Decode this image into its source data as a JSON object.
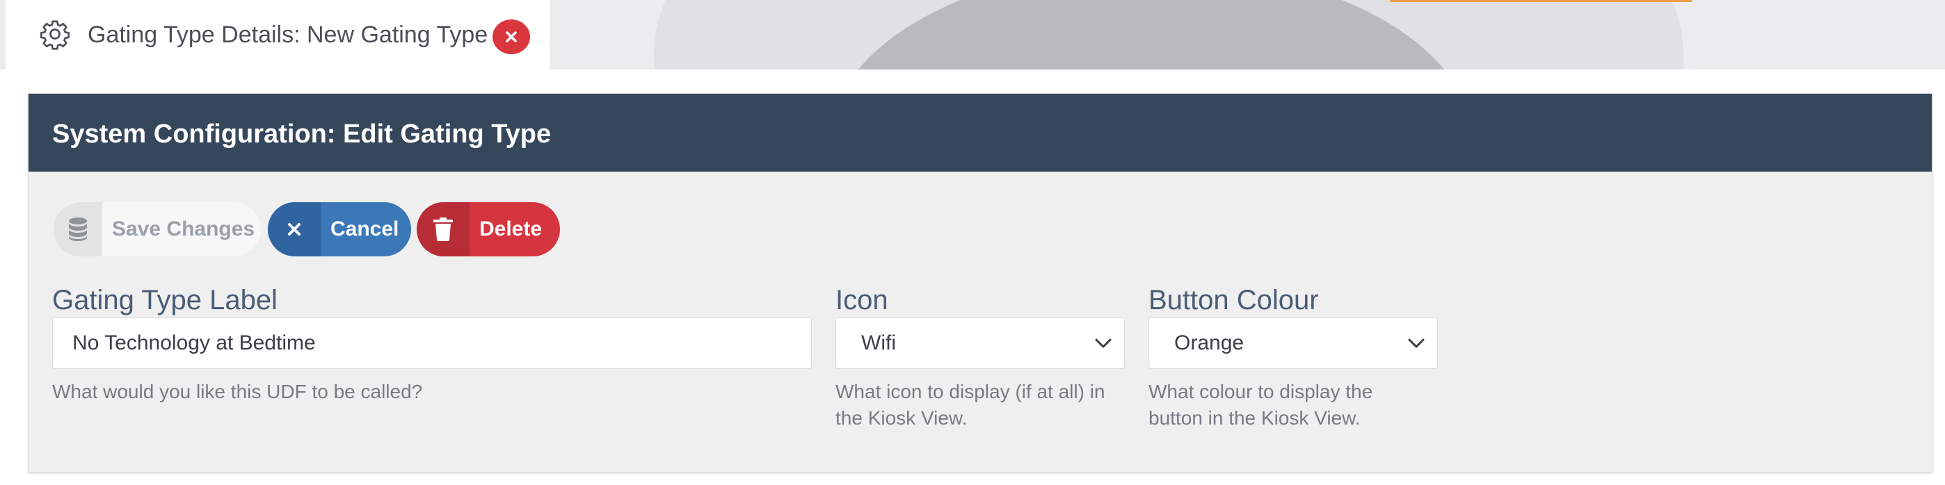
{
  "tab": {
    "icon": "gear-icon",
    "title": "Gating Type Details: New Gating Type",
    "close_icon": "close-icon"
  },
  "panel": {
    "title": "System Configuration: Edit Gating Type"
  },
  "toolbar": {
    "save_label": "Save Changes",
    "save_icon": "database-icon",
    "cancel_label": "Cancel",
    "cancel_icon": "close-icon",
    "delete_label": "Delete",
    "delete_icon": "trash-icon"
  },
  "form": {
    "label_field": {
      "label": "Gating Type Label",
      "value": "No Technology at Bedtime",
      "help": "What would you like this UDF to be called?"
    },
    "icon_field": {
      "label": "Icon",
      "value": "Wifi",
      "help": "What icon to display (if at all) in the Kiosk View."
    },
    "colour_field": {
      "label": "Button Colour",
      "value": "Orange",
      "help": "What colour to display the button in the Kiosk View."
    }
  },
  "colors": {
    "header": "#36475b",
    "cancel": "#3a78b8",
    "delete": "#d5353f",
    "label_text": "#4b5c75"
  }
}
